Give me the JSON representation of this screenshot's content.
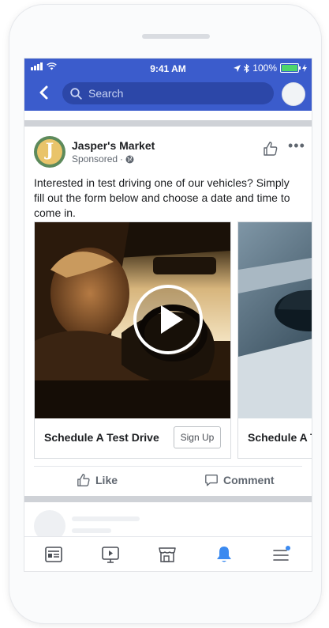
{
  "status_bar": {
    "time": "9:41 AM",
    "battery": "100%",
    "battery_level": 1.0
  },
  "header": {
    "search_placeholder": "Search"
  },
  "post": {
    "page_name": "Jasper's Market",
    "avatar_letter": "J",
    "sponsored_label": "Sponsored",
    "body_text": "Interested in test driving one of our vehicles? Simply fill out the form below and choose a date and time to come in.",
    "cards": [
      {
        "caption": "Schedule A Test Drive",
        "cta": "Sign Up"
      },
      {
        "caption": "Schedule A Test Drive"
      }
    ],
    "actions": {
      "like": "Like",
      "comment": "Comment"
    }
  },
  "tabs": [
    "news-feed",
    "watch",
    "marketplace",
    "notifications",
    "menu"
  ],
  "colors": {
    "brand_blue": "#3b5ccc",
    "search_bg": "#2c47a8",
    "active_tab": "#3b8af0",
    "battery_green": "#4ed56a"
  }
}
